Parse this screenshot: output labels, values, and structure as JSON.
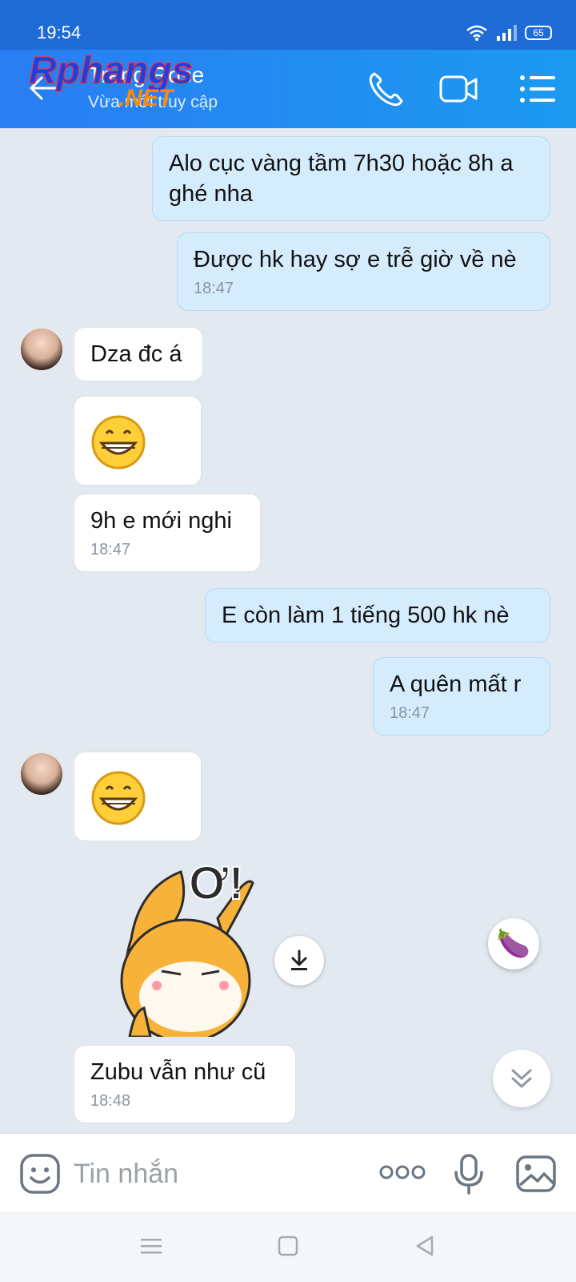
{
  "status_bar": {
    "time": "19:54",
    "battery": "65"
  },
  "header": {
    "contact_name": "Trang Rose",
    "presence": "Vừa mới truy cập",
    "watermark_text_1": "Rphangs",
    "watermark_text_2": ".NET"
  },
  "messages": [
    {
      "dir": "out",
      "text": "Alo cục vàng tầm 7h30 hoặc 8h a ghé nha"
    },
    {
      "dir": "out",
      "text": "Được hk hay sợ e trễ giờ về nè",
      "time": "18:47"
    },
    {
      "dir": "in",
      "text": "Dza đc á"
    },
    {
      "dir": "in",
      "emoji": "grinning-face"
    },
    {
      "dir": "in",
      "text": "9h e mới nghi",
      "time": "18:47"
    },
    {
      "dir": "out",
      "text": "E còn làm 1 tiếng 500 hk nè"
    },
    {
      "dir": "out",
      "text": "A quên mất r",
      "time": "18:47"
    },
    {
      "dir": "in",
      "emoji": "grinning-face"
    },
    {
      "dir": "in",
      "sticker": "fox-sticker",
      "sticker_text": "Ơ!"
    },
    {
      "dir": "in",
      "text": "Zubu vẫn như cũ",
      "time": "18:48"
    }
  ],
  "floating": {
    "reaction_emoji": "🍆"
  },
  "input_bar": {
    "placeholder": "Tin nhắn"
  },
  "colors": {
    "header": "#2a7df2",
    "outgoing": "#d5ecfd",
    "incoming": "#ffffff",
    "background": "#e2e9f1"
  }
}
